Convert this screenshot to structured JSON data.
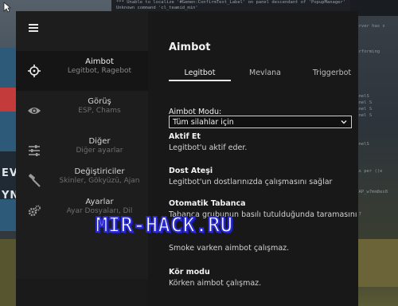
{
  "console": {
    "line1": "*** Unable to localize '#Gemen:ConfirmText_Label' on panel descendant of 'PopupManager'",
    "line2": "Unknown command 'cl_teamid_min'",
    "side_lines": [
      "server has s",
      "Performing",
      "PanelS",
      "Panel S",
      "Panel S",
      "Panel S",
      "PanelS",
      "(As per ((e",
      "11AP_w7mm8ex8",
      "w_7"
    ]
  },
  "background": {
    "wall_text_1": "EVL",
    "wall_text_2": "YNA"
  },
  "sidebar": {
    "items": [
      {
        "title": "Aimbot",
        "subtitle": "Legitbot, Ragebot",
        "icon": "crosshair-icon"
      },
      {
        "title": "Görüş",
        "subtitle": "ESP, Chams",
        "icon": "eye-icon"
      },
      {
        "title": "Diğer",
        "subtitle": "Diğer ayarlar",
        "icon": "sliders-icon"
      },
      {
        "title": "Değiştiriciler",
        "subtitle": "Skinler, Gökyüzü, Ajan",
        "icon": "hammer-icon"
      },
      {
        "title": "Ayarlar",
        "subtitle": "Ayar Dosyaları, Dil",
        "icon": "gears-icon"
      }
    ]
  },
  "panel": {
    "title": "Aimbot",
    "tabs": [
      "Legitbot",
      "Mevlana",
      "Triggerbot"
    ],
    "mode_label": "Aimbot Modu:",
    "mode_value": "Tüm silahlar için",
    "options": [
      {
        "title": "Aktif Et",
        "desc": "Legitbot'u aktif eder."
      },
      {
        "title": "Dost Ateşi",
        "desc": "Legitbot'un dostlarınızda çalışmasını sağlar"
      },
      {
        "title": "Otomatik Tabanca",
        "desc": "Tabanca grubunun basılı tutulduğunda taramasını"
      },
      {
        "title": "",
        "desc": "Smoke varken aimbot çalışmaz."
      },
      {
        "title": "Kör modu",
        "desc": "Körken aimbot çalışmaz."
      }
    ]
  },
  "watermark": "MIR-HACK.RU",
  "colors": {
    "sidebar_bg": "#1d1d1d",
    "panel_bg": "#181818",
    "watermark_stroke": "#2a2ad8"
  }
}
